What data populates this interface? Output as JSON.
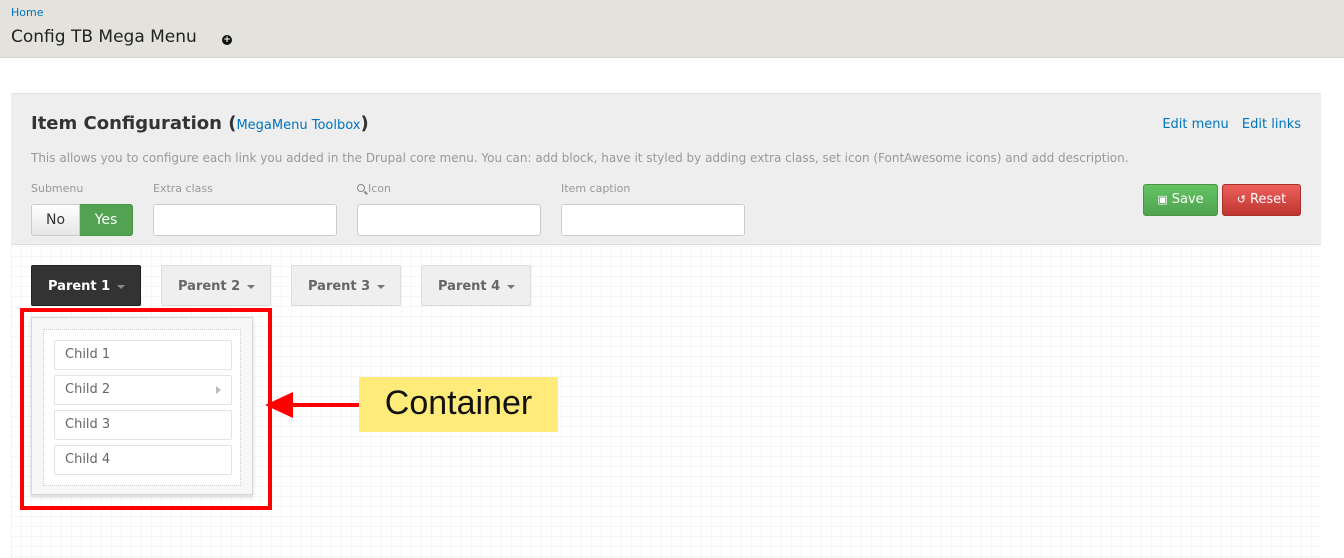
{
  "header": {
    "breadcrumb": "Home",
    "title": "Config TB Mega Menu",
    "shortcut_symbol": "+"
  },
  "toolbox": {
    "title": "Item Configuration",
    "paren_open": "(",
    "paren_close": ")",
    "toolbox_link": "MegaMenu Toolbox",
    "edit_menu": "Edit menu",
    "edit_links": "Edit links",
    "description": "This allows you to configure each link you added in the Drupal core menu. You can: add block, have it styled by adding extra class, set icon (FontAwesome icons) and add description.",
    "submenu_label": "Submenu",
    "submenu_no": "No",
    "submenu_yes": "Yes",
    "submenu_value": "Yes",
    "extra_class_label": "Extra class",
    "extra_class_value": "",
    "icon_label": "Icon",
    "icon_value": "",
    "item_caption_label": "Item caption",
    "item_caption_value": "",
    "save_label": "Save",
    "reset_label": "Reset"
  },
  "menu": {
    "parents": [
      "Parent 1",
      "Parent 2",
      "Parent 3",
      "Parent 4"
    ],
    "active_parent": "Parent 1",
    "children": [
      "Child 1",
      "Child 2",
      "Child 3",
      "Child 4"
    ],
    "child_with_submenu": "Child 2"
  },
  "annotation": {
    "label": "Container",
    "highlight_color": "#ff0000",
    "label_bg": "#ffeb7a"
  },
  "colors": {
    "link": "#0074bd",
    "save": "#51a351",
    "reset": "#bd362f",
    "active_parent": "#333333"
  }
}
